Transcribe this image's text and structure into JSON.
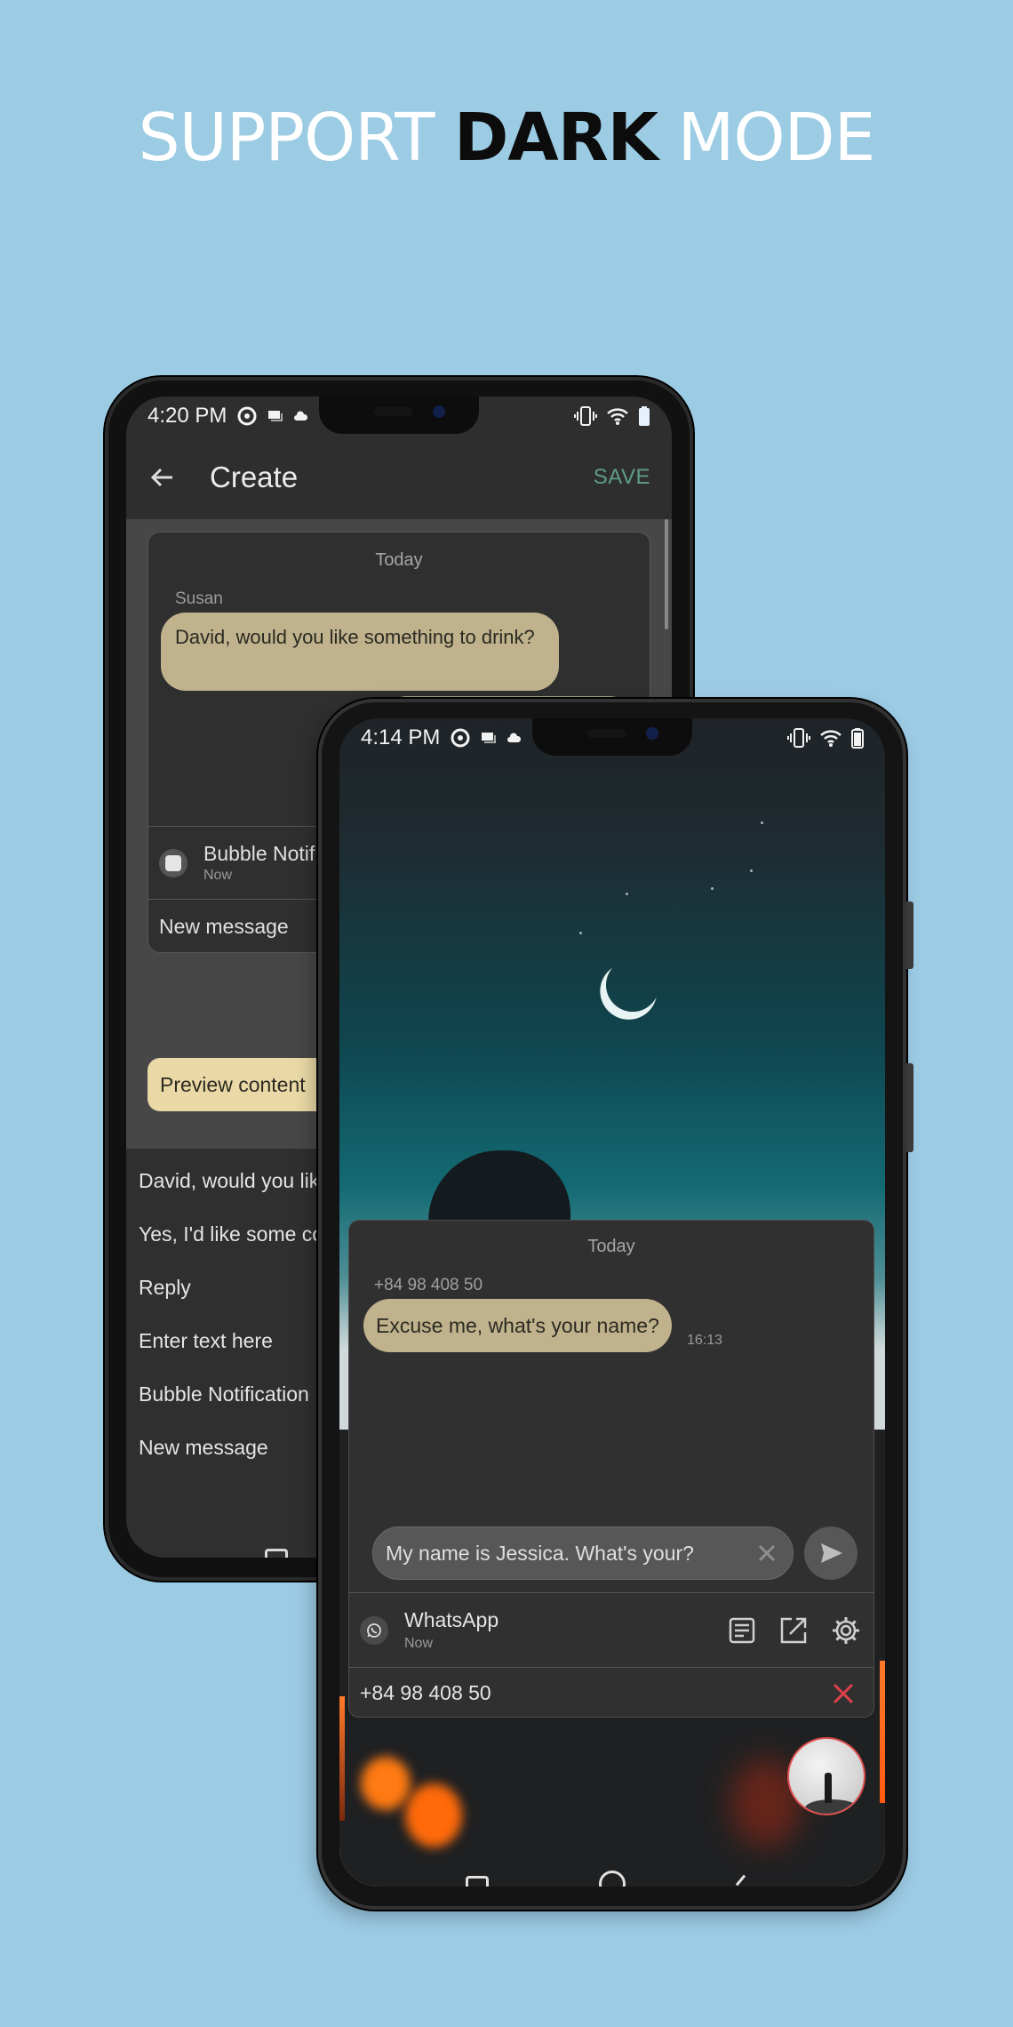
{
  "headline": {
    "part1": "SUPPORT ",
    "highlight": "DARK",
    "part2": " MODE",
    "colors": {
      "normal": "#ffffff",
      "highlight": "#0c0c0c",
      "background": "#9ccbe4"
    }
  },
  "back_phone": {
    "status_bar": {
      "time": "4:20 PM",
      "left_icons": [
        "blackberry-icon",
        "message-icon",
        "cloud-icon"
      ],
      "right_icons": [
        "vibrate-icon",
        "wifi-icon",
        "battery-icon"
      ]
    },
    "app_bar": {
      "back_icon": "arrow-left-icon",
      "title": "Create",
      "save_label": "SAVE",
      "save_color": "#5f9e86"
    },
    "preview_card": {
      "date_label": "Today",
      "sender": "Susan",
      "message": "David, would you like something to drink?",
      "notification": {
        "title": "Bubble Notif",
        "time": "Now"
      },
      "new_message_label": "New message"
    },
    "preview_chip_label": "Preview content",
    "message_list": [
      "David, would you lik",
      "Yes, I'd like some co",
      "Reply",
      "Enter text here",
      "Bubble Notification",
      "New message"
    ]
  },
  "front_phone": {
    "status_bar": {
      "time": "4:14 PM",
      "left_icons": [
        "blackberry-icon",
        "message-icon",
        "cloud-icon"
      ],
      "right_icons": [
        "vibrate-icon",
        "wifi-icon",
        "battery-icon"
      ]
    },
    "chat": {
      "date_label": "Today",
      "sender": "+84 98 408 50",
      "message": "Excuse me, what's your name?",
      "time": "16:13",
      "reply_value": "My name is Jessica.  What's your?",
      "bubble_color": "#bfb28c"
    },
    "app_row": {
      "app_name": "WhatsApp",
      "time": "Now",
      "actions": [
        "notes-icon",
        "open-external-icon",
        "settings-gear-icon"
      ]
    },
    "contact_row": {
      "number": "+84 98 408 50",
      "close_color": "#e0404a"
    }
  }
}
